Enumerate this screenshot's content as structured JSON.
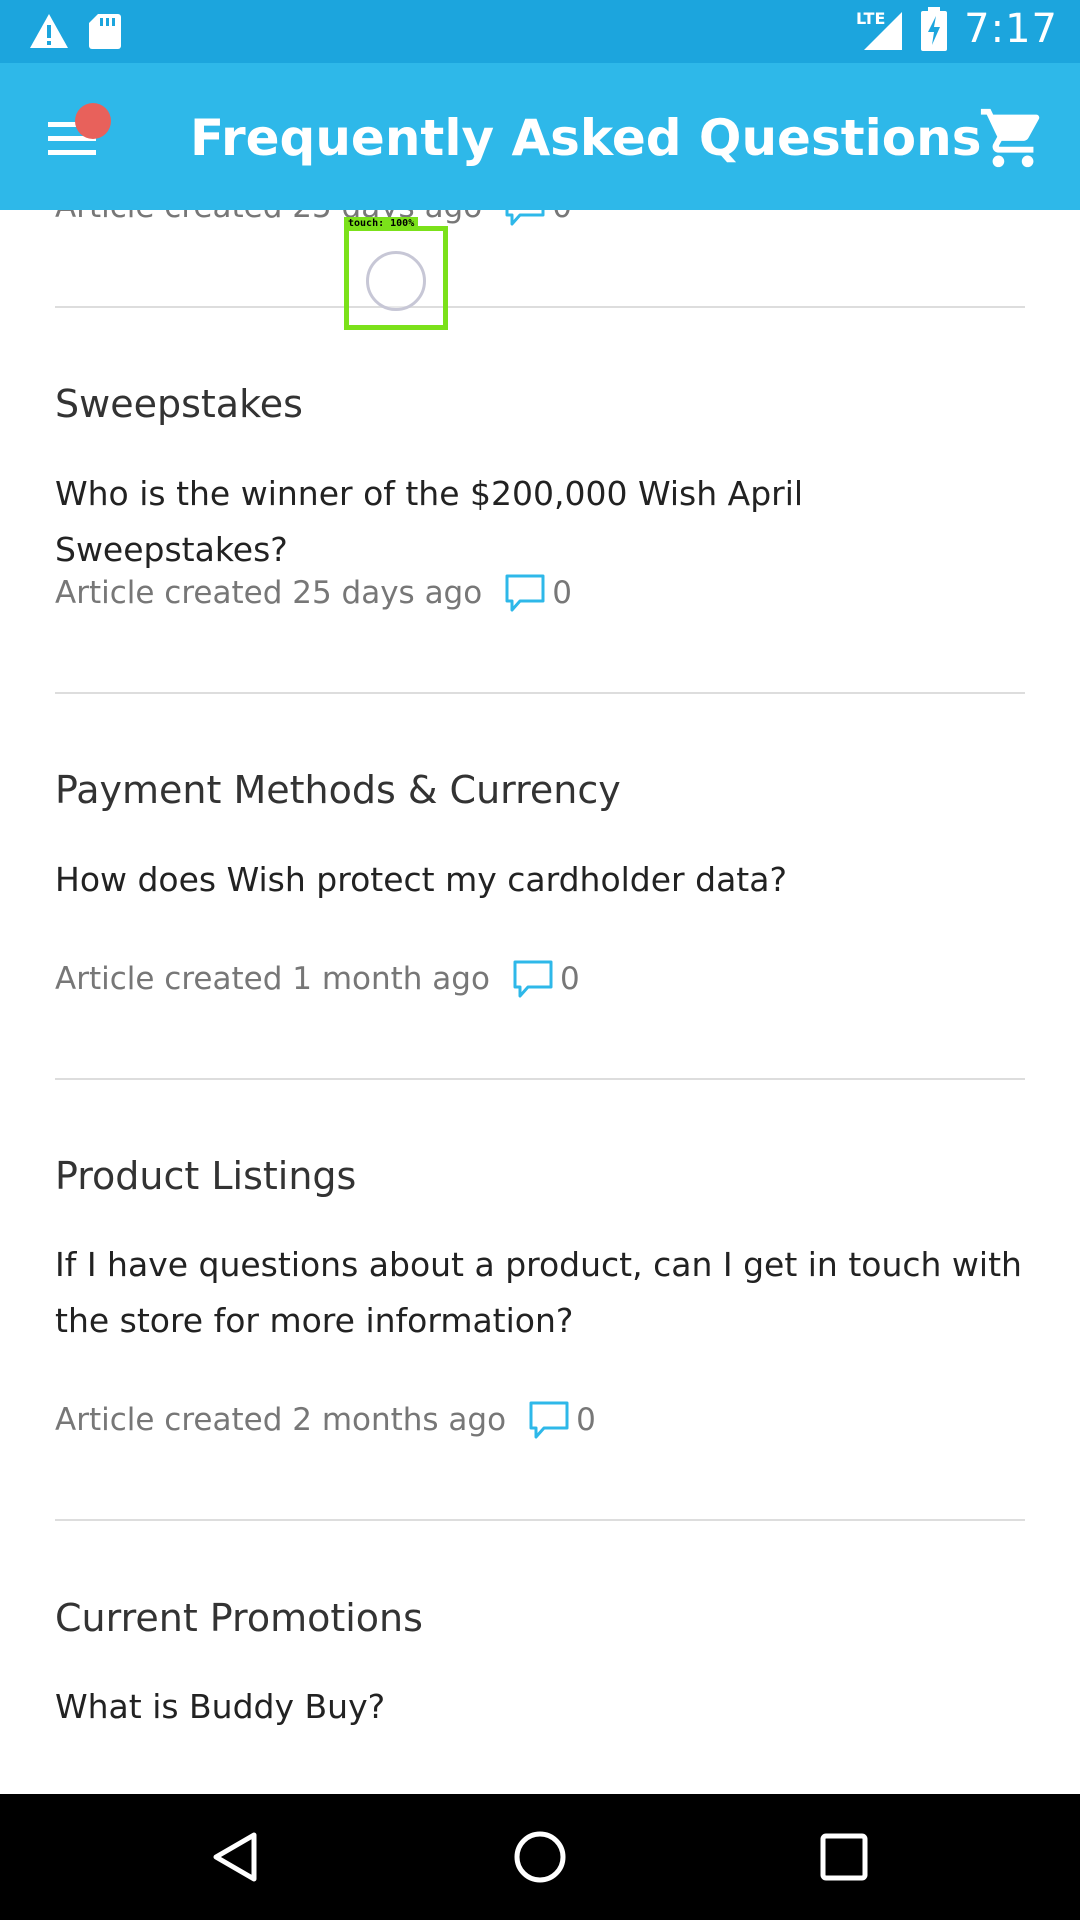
{
  "status_bar": {
    "time": "7:17",
    "network": "LTE",
    "icons": [
      "warning-icon",
      "sd-card-icon",
      "signal-icon",
      "battery-charging-icon"
    ]
  },
  "app_bar": {
    "title": "Frequently Asked Questions",
    "menu_icon": "menu-icon",
    "cart_icon": "cart-icon",
    "badge_color": "#e8615b"
  },
  "articles": [
    {
      "meta": "Article created 25 days ago",
      "comments": "0"
    },
    {
      "category": "Sweepstakes",
      "question": "Who is the winner of the $200,000 Wish April Sweepstakes?",
      "meta": "Article created 25 days ago",
      "comments": "0"
    },
    {
      "category": "Payment Methods & Currency",
      "question": "How does Wish protect my cardholder data?",
      "meta": "Article created 1 month ago",
      "comments": "0"
    },
    {
      "category": "Product Listings",
      "question": "If I have questions about a product, can I get in touch with the store for more information?",
      "meta": "Article created 2 months ago",
      "comments": "0"
    },
    {
      "category": "Current Promotions",
      "question": "What is Buddy Buy?"
    }
  ],
  "touch_overlay": {
    "label": "touch: 100%"
  },
  "colors": {
    "status_bar": "#1ca5dd",
    "app_bar": "#2eb8e9",
    "comment_icon": "#2eb8e9",
    "touch_box": "#7be11a"
  }
}
